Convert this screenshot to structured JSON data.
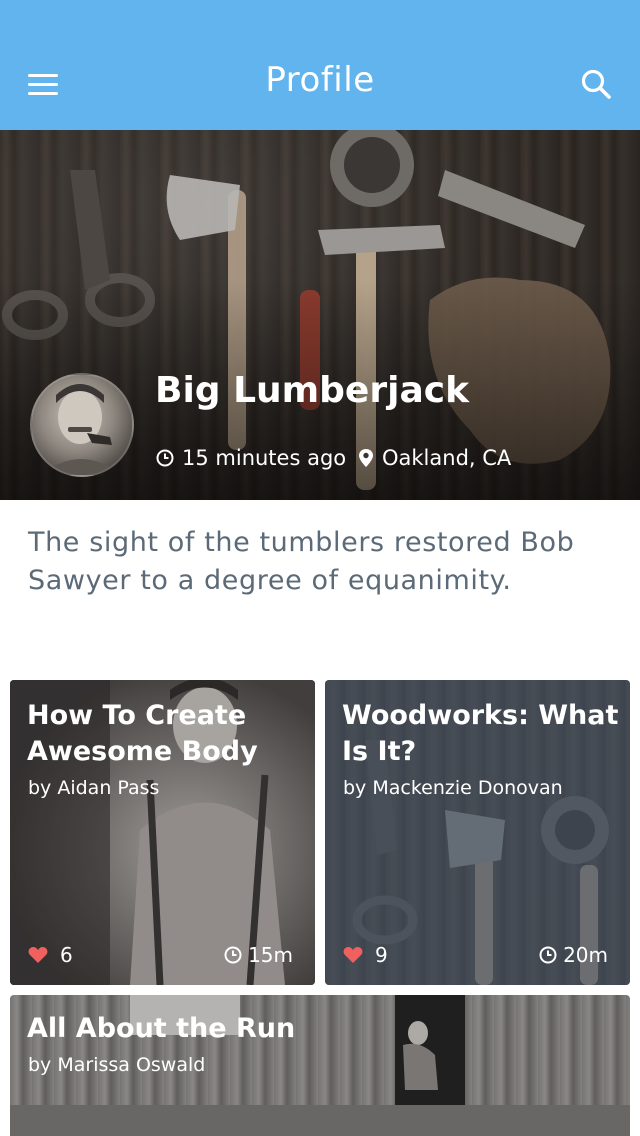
{
  "header": {
    "title": "Profile",
    "menu_icon": "hamburger-menu-icon",
    "search_icon": "search-icon"
  },
  "profile": {
    "name": "Big Lumberjack",
    "time": "15 minutes ago",
    "location": "Oakland, CA",
    "bio": "The sight of the tumblers restored Bob Sawyer to a degree of equanimity."
  },
  "colors": {
    "header_bg": "#62b4ee",
    "heart": "#f0605e",
    "bio_text": "#5c6a78"
  },
  "cards": [
    {
      "title": "How To Create Awesome Body",
      "author": "by Aidan Pass",
      "likes": "6",
      "duration": "15m"
    },
    {
      "title": "Woodworks: What Is It?",
      "author": "by Mackenzie Donovan",
      "likes": "9",
      "duration": "20m"
    },
    {
      "title": "All About the Run",
      "author": "by Marissa Oswald"
    }
  ]
}
